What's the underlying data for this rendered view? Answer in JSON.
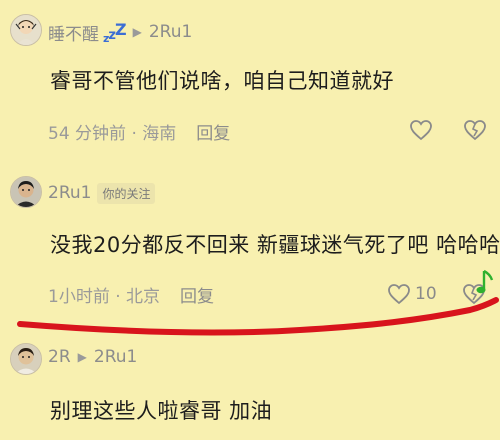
{
  "comments": [
    {
      "username": "睡不醒",
      "reply_to": "2Ru1",
      "text": "睿哥不管他们说啥，咱自己知道就好",
      "time_location": "54 分钟前 · 海南",
      "reply_label": "回复",
      "likes": ""
    },
    {
      "username": "2Ru1",
      "tag": "你的关注",
      "text": "没我20分都反不回来 新疆球迷气死了吧 哈哈哈",
      "time_location": "1小时前 · 北京",
      "reply_label": "回复",
      "likes": "10"
    },
    {
      "username": "2R",
      "reply_to": "2Ru1",
      "text": "别理这些人啦睿哥 加油"
    }
  ],
  "zzz": [
    "z",
    "z",
    "Z"
  ],
  "icons": {
    "heart": "heart-icon",
    "broken_heart": "broken-heart-icon",
    "music_note": "music-note-icon",
    "play_arrow": "play-arrow-icon"
  },
  "colors": {
    "background": "#f8f0b0",
    "annotation_red": "#d8141c",
    "music_green": "#2fb12f",
    "zzz_blue": "#3c6ed4"
  }
}
